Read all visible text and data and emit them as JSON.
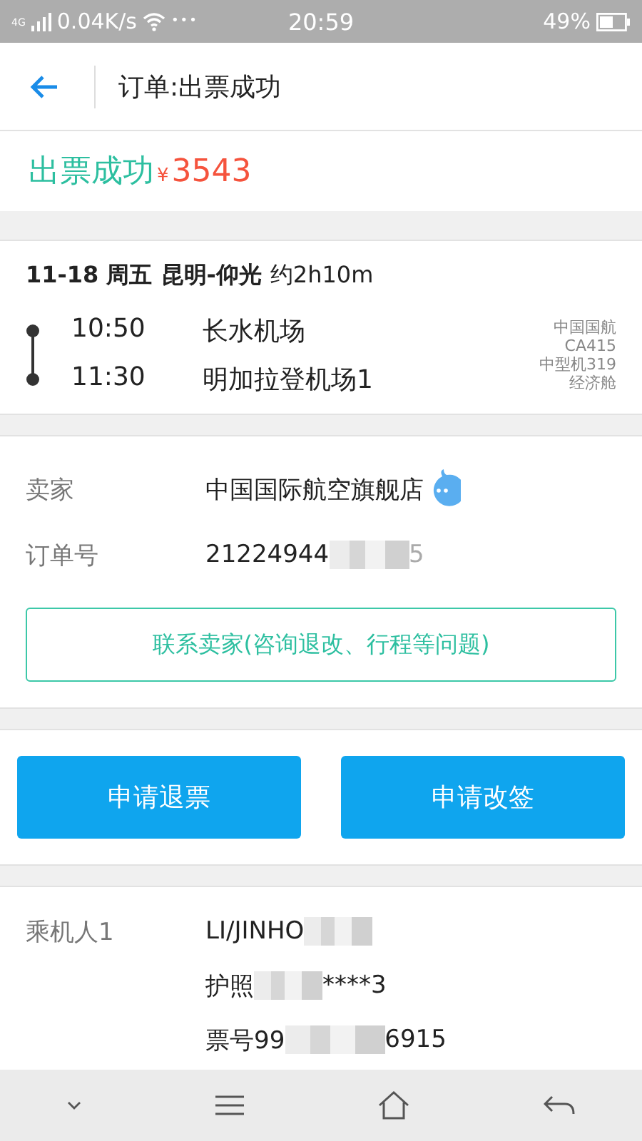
{
  "status_bar": {
    "network": "4G",
    "speed": "0.04K/s",
    "dots": "•••",
    "time": "20:59",
    "battery": "49%"
  },
  "header": {
    "title": "订单:出票成功"
  },
  "summary": {
    "status": "出票成功",
    "currency": "¥",
    "price": "3543"
  },
  "flight": {
    "date": "11-18 周五",
    "route": "昆明-仰光",
    "duration": "约2h10m",
    "stops": [
      {
        "time": "10:50",
        "airport": "长水机场"
      },
      {
        "time": "11:30",
        "airport": "明加拉登机场1"
      }
    ],
    "info": [
      "中国国航",
      "CA415",
      "中型机319",
      "经济舱"
    ]
  },
  "seller": {
    "seller_label": "卖家",
    "seller_name": "中国国际航空旗舰店",
    "order_label": "订单号",
    "order_number": "21224944",
    "order_tail": "5",
    "contact_button": "联系卖家(咨询退改、行程等问题)"
  },
  "actions": [
    "申请退票",
    "申请改签"
  ],
  "passenger": {
    "label": "乘机人1",
    "name": "LI/JINHO",
    "passport_label": "护照",
    "passport_tail": "****3",
    "ticket_label": "票号99",
    "ticket_tail": "6915"
  }
}
